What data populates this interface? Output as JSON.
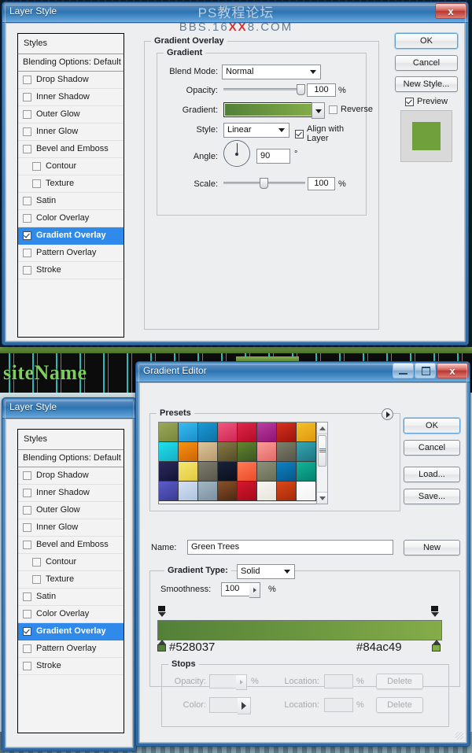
{
  "watermark": {
    "line1": "PS教程论坛",
    "line2_pre": "BBS.16",
    "line2_red": "XX",
    "line2_post": "8.COM"
  },
  "background": {
    "site_name": "siteName"
  },
  "layer_style_top": {
    "title": "Layer Style",
    "close_label": "x",
    "styles_header": "Styles",
    "blending_options": "Blending Options: Default",
    "effects": [
      {
        "label": "Drop Shadow",
        "checked": false,
        "sub": false,
        "selected": false
      },
      {
        "label": "Inner Shadow",
        "checked": false,
        "sub": false,
        "selected": false
      },
      {
        "label": "Outer Glow",
        "checked": false,
        "sub": false,
        "selected": false
      },
      {
        "label": "Inner Glow",
        "checked": false,
        "sub": false,
        "selected": false
      },
      {
        "label": "Bevel and Emboss",
        "checked": false,
        "sub": false,
        "selected": false
      },
      {
        "label": "Contour",
        "checked": false,
        "sub": true,
        "selected": false
      },
      {
        "label": "Texture",
        "checked": false,
        "sub": true,
        "selected": false
      },
      {
        "label": "Satin",
        "checked": false,
        "sub": false,
        "selected": false
      },
      {
        "label": "Color Overlay",
        "checked": false,
        "sub": false,
        "selected": false
      },
      {
        "label": "Gradient Overlay",
        "checked": true,
        "sub": false,
        "selected": true
      },
      {
        "label": "Pattern Overlay",
        "checked": false,
        "sub": false,
        "selected": false
      },
      {
        "label": "Stroke",
        "checked": false,
        "sub": false,
        "selected": false
      }
    ],
    "panel_title": "Gradient Overlay",
    "group_title": "Gradient",
    "fields": {
      "blend_mode_label": "Blend Mode:",
      "blend_mode_value": "Normal",
      "opacity_label": "Opacity:",
      "opacity_value": "100",
      "opacity_unit": "%",
      "gradient_label": "Gradient:",
      "reverse_label": "Reverse",
      "reverse_checked": false,
      "style_label": "Style:",
      "style_value": "Linear",
      "align_label": "Align with Layer",
      "align_checked": true,
      "angle_label": "Angle:",
      "angle_value": "90",
      "angle_unit": "°",
      "scale_label": "Scale:",
      "scale_value": "100",
      "scale_unit": "%"
    },
    "buttons": {
      "ok": "OK",
      "cancel": "Cancel",
      "new_style": "New Style...",
      "preview_label": "Preview",
      "preview_checked": true
    },
    "preview_color": "#6fa03c"
  },
  "layer_style_bottom": {
    "title": "Layer Style",
    "styles_header": "Styles",
    "blending_options": "Blending Options: Default",
    "effects": [
      {
        "label": "Drop Shadow",
        "checked": false,
        "sub": false,
        "selected": false
      },
      {
        "label": "Inner Shadow",
        "checked": false,
        "sub": false,
        "selected": false
      },
      {
        "label": "Outer Glow",
        "checked": false,
        "sub": false,
        "selected": false
      },
      {
        "label": "Inner Glow",
        "checked": false,
        "sub": false,
        "selected": false
      },
      {
        "label": "Bevel and Emboss",
        "checked": false,
        "sub": false,
        "selected": false
      },
      {
        "label": "Contour",
        "checked": false,
        "sub": true,
        "selected": false
      },
      {
        "label": "Texture",
        "checked": false,
        "sub": true,
        "selected": false
      },
      {
        "label": "Satin",
        "checked": false,
        "sub": false,
        "selected": false
      },
      {
        "label": "Color Overlay",
        "checked": false,
        "sub": false,
        "selected": false
      },
      {
        "label": "Gradient Overlay",
        "checked": true,
        "sub": false,
        "selected": true
      },
      {
        "label": "Pattern Overlay",
        "checked": false,
        "sub": false,
        "selected": false
      },
      {
        "label": "Stroke",
        "checked": false,
        "sub": false,
        "selected": false
      }
    ]
  },
  "gradient_editor": {
    "title": "Gradient Editor",
    "minimize_label": "",
    "maximize_label": "",
    "close_label": "x",
    "presets_label": "Presets",
    "buttons": {
      "ok": "OK",
      "cancel": "Cancel",
      "load": "Load...",
      "save": "Save...",
      "new": "New"
    },
    "name_label": "Name:",
    "name_value": "Green Trees",
    "gradient_type_label": "Gradient Type:",
    "gradient_type_value": "Solid",
    "smoothness_label": "Smoothness:",
    "smoothness_value": "100",
    "smoothness_unit": "%",
    "gradient_start_hex": "#528037",
    "gradient_end_hex": "#84ac49",
    "stops_label": "Stops",
    "stops": {
      "opacity_label": "Opacity:",
      "opacity_value": "",
      "opacity_unit": "%",
      "location_label_1": "Location:",
      "location_value_1": "",
      "location_unit_1": "%",
      "delete_1": "Delete",
      "color_label": "Color:",
      "location_label_2": "Location:",
      "location_value_2": "",
      "location_unit_2": "%",
      "delete_2": "Delete"
    },
    "preset_swatches": [
      "#8b9a4a",
      "#29a8dd",
      "#1585bd",
      "#e13e6b",
      "#cf1436",
      "#a7258a",
      "#bd2016",
      "#e9ae1b",
      "#1fc9d8",
      "#e27c0c",
      "#cbb185",
      "#6e6236",
      "#4f6f2a",
      "#f0827f",
      "#6c6c5b",
      "#2a8e9a",
      "#21214a",
      "#eedb59",
      "#6c6b5d",
      "#121a2a",
      "#f8643f",
      "#7d8168",
      "#0b6ba6",
      "#0c9a84",
      "#4a4bb0",
      "#c3d3ea",
      "#8fa7b4",
      "#6a3c1e",
      "#c01028",
      "#f1f0ea",
      "#c2380f",
      "#fbfbfb"
    ],
    "preset_swatch_pairs": [
      [
        "#9aa85a",
        "#77873b"
      ],
      [
        "#37bdf0",
        "#1b8ec9"
      ],
      [
        "#1c9ad4",
        "#0d72a6"
      ],
      [
        "#ef5a80",
        "#d02552"
      ],
      [
        "#e0284a",
        "#b50a28"
      ],
      [
        "#bb3da1",
        "#8e1472"
      ],
      [
        "#d43222",
        "#a0130b"
      ],
      [
        "#f6bf2c",
        "#dd990b"
      ],
      [
        "#1ee0ee",
        "#16aec3"
      ],
      [
        "#f59411",
        "#cd6306"
      ],
      [
        "#dbc49d",
        "#b89a6a"
      ],
      [
        "#867a47",
        "#564c26"
      ],
      [
        "#61862f",
        "#3a5520"
      ],
      [
        "#fb9a97",
        "#e26a66"
      ],
      [
        "#7e7e6c",
        "#56564a"
      ],
      [
        "#35a7b3",
        "#1e7480"
      ],
      [
        "#2a2a5c",
        "#131336"
      ],
      [
        "#f6e671",
        "#e2cb41"
      ],
      [
        "#7d7c6d",
        "#59584b"
      ],
      [
        "#19233a",
        "#0a0f1c"
      ],
      [
        "#ff7a55",
        "#ea4c27"
      ],
      [
        "#8d917a",
        "#6a6d56"
      ],
      [
        "#0e82c4",
        "#07578a"
      ],
      [
        "#10b49a",
        "#07816e"
      ],
      [
        "#5b5cc9",
        "#3a3b94"
      ],
      [
        "#d4e0f2",
        "#aec3de"
      ],
      [
        "#a2b8c4",
        "#7a90a0"
      ],
      [
        "#8a5228",
        "#4c2813"
      ],
      [
        "#d5172f",
        "#a60a1c"
      ],
      [
        "#f7f6f1",
        "#e6e4da"
      ],
      [
        "#d9481a",
        "#a62a08"
      ],
      [
        "#ffffff",
        "#f2f2f2"
      ]
    ]
  }
}
